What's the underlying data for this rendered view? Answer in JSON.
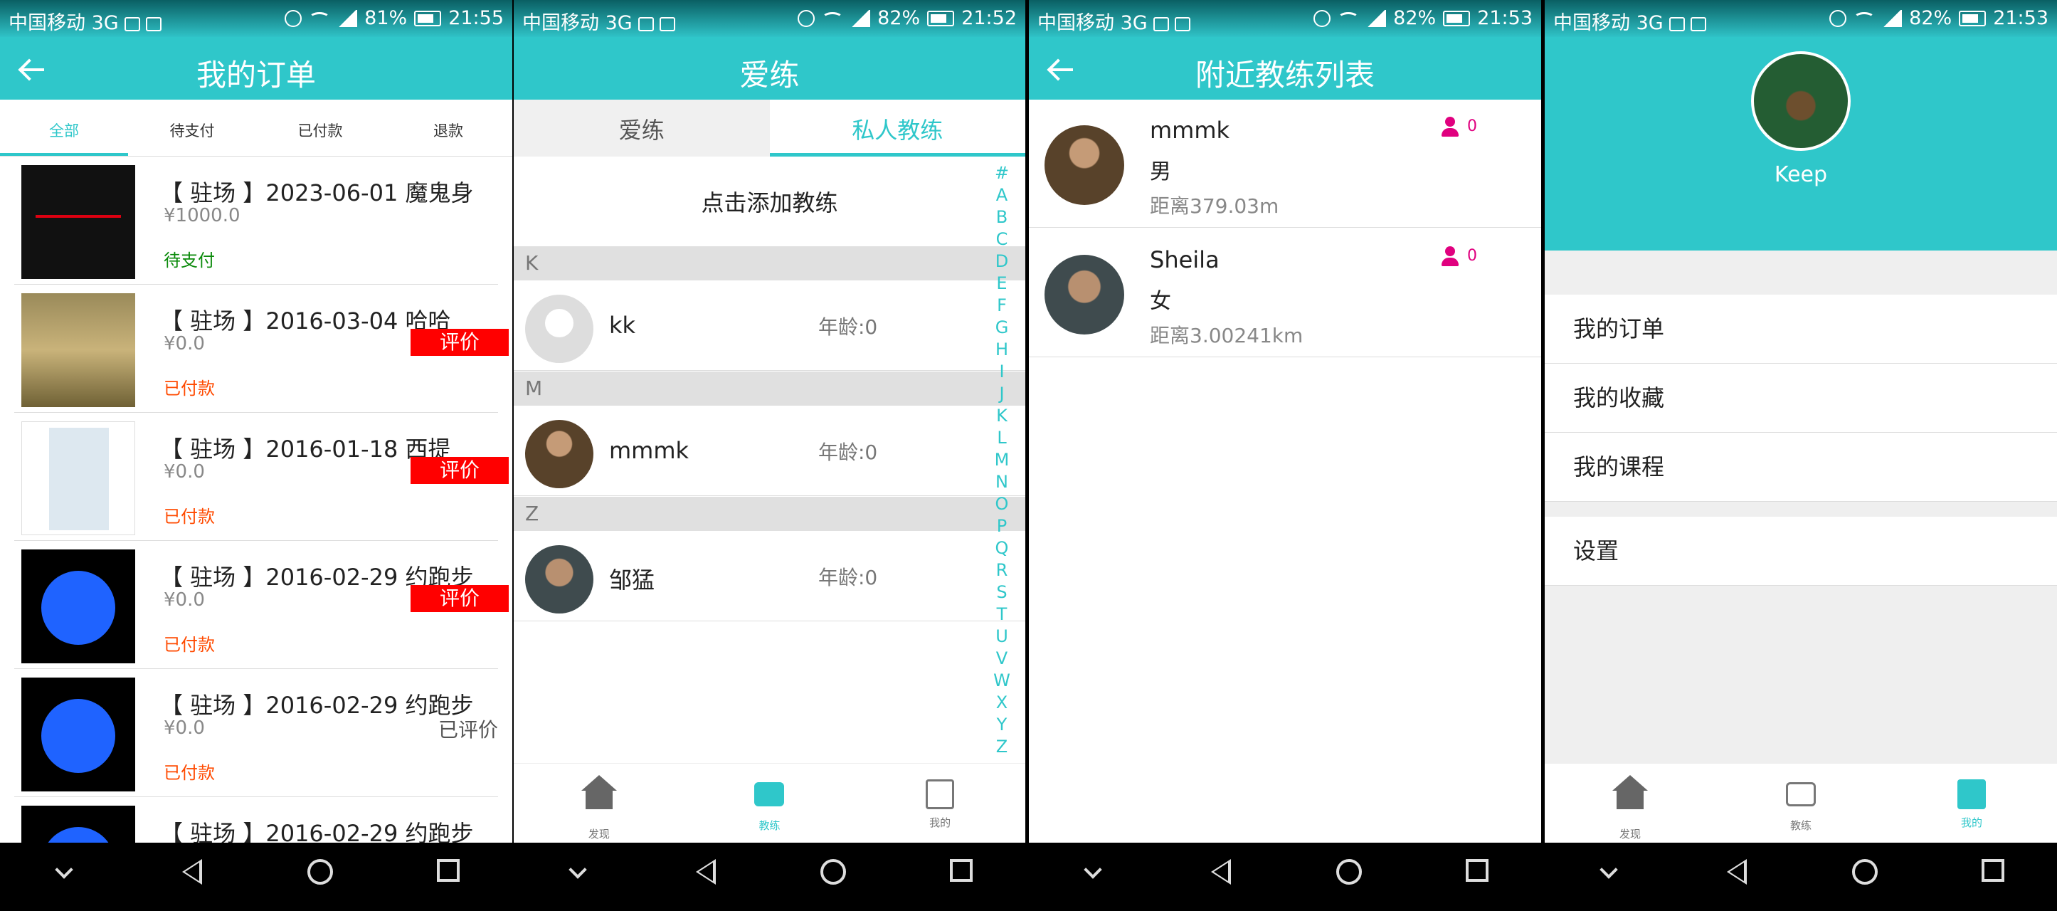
{
  "status": [
    {
      "carrier": "中国移动 3G",
      "percent": "81%",
      "time": "21:55"
    },
    {
      "carrier": "中国移动 3G",
      "percent": "82%",
      "time": "21:52"
    },
    {
      "carrier": "中国移动 3G",
      "percent": "82%",
      "time": "21:53"
    },
    {
      "carrier": "中国移动 3G",
      "percent": "82%",
      "time": "21:53"
    }
  ],
  "orders": {
    "title": "我的订单",
    "tabs": [
      "全部",
      "待支付",
      "已付款",
      "退款"
    ],
    "items": [
      {
        "title": "【 驻场 】2023-06-01 魔鬼身",
        "price": "¥1000.0",
        "status": "待支付",
        "action": ""
      },
      {
        "title": "【 驻场 】2016-03-04 哈哈",
        "price": "¥0.0",
        "status": "已付款",
        "action": "评价"
      },
      {
        "title": "【 驻场 】2016-01-18 西提",
        "price": "¥0.0",
        "status": "已付款",
        "action": "评价"
      },
      {
        "title": "【 驻场 】2016-02-29 约跑步",
        "price": "¥0.0",
        "status": "已付款",
        "action": "评价"
      },
      {
        "title": "【 驻场 】2016-02-29 约跑步",
        "price": "¥0.0",
        "status": "已付款",
        "action": "已评价"
      },
      {
        "title": "【 驻场 】2016-02-29 约跑步",
        "price": "",
        "status": "",
        "action": ""
      }
    ]
  },
  "coaches": {
    "title": "爱练",
    "tabs": [
      "爱练",
      "私人教练"
    ],
    "add": "点击添加教练",
    "sections": [
      "K",
      "M",
      "Z"
    ],
    "items": [
      {
        "name": "kk",
        "age": "年龄:0"
      },
      {
        "name": "mmmk",
        "age": "年龄:0"
      },
      {
        "name": "邹猛",
        "age": "年龄:0"
      }
    ],
    "index": [
      "#",
      "A",
      "B",
      "C",
      "D",
      "E",
      "F",
      "G",
      "H",
      "I",
      "J",
      "K",
      "L",
      "M",
      "N",
      "O",
      "P",
      "Q",
      "R",
      "S",
      "T",
      "U",
      "V",
      "W",
      "X",
      "Y",
      "Z"
    ]
  },
  "nearby": {
    "title": "附近教练列表",
    "items": [
      {
        "name": "mmmk",
        "gender": "男",
        "distance": "距离379.03m",
        "count": "0"
      },
      {
        "name": "Sheila",
        "gender": "女",
        "distance": "距离3.00241km",
        "count": "0"
      }
    ]
  },
  "profile": {
    "name": "Keep",
    "menu": [
      "我的订单",
      "我的收藏",
      "我的课程"
    ],
    "settings": "设置"
  },
  "tabbar": {
    "discover": "发现",
    "coach": "教练",
    "mine": "我的"
  },
  "colors": {
    "accent": "#2fc7ca",
    "red_button": "#ff0000",
    "paid": "#ff4a00",
    "unpaid": "#0a8a0a",
    "badge": "#e0007f"
  }
}
